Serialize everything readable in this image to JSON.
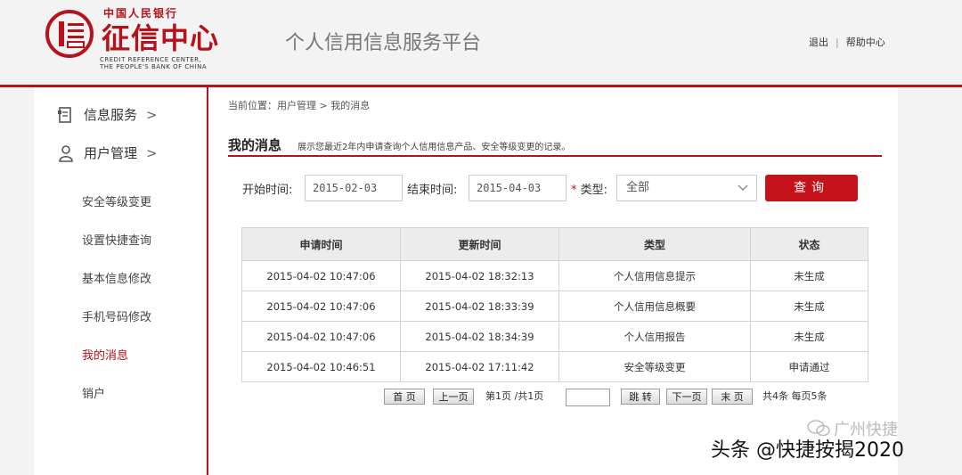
{
  "header": {
    "logo_small": "中国人民银行",
    "logo_big": "征信中心",
    "logo_en_line1": "CREDIT REFERENCE CENTER,",
    "logo_en_line2": "THE PEOPLE'S BANK OF CHINA",
    "platform_title": "个人信用信息服务平台",
    "logout": "退出",
    "separator": "|",
    "help": "帮助中心"
  },
  "sidebar": {
    "info_service": "信息服务",
    "user_mgmt": "用户管理",
    "arrow": ">",
    "items": [
      {
        "label": "安全等级变更"
      },
      {
        "label": "设置快捷查询"
      },
      {
        "label": "基本信息修改"
      },
      {
        "label": "手机号码修改"
      },
      {
        "label": "我的消息"
      },
      {
        "label": "销户"
      }
    ]
  },
  "breadcrumb": "当前位置：用户管理 > 我的消息",
  "page": {
    "title": "我的消息",
    "desc": "展示您最近2年内申请查询个人信用信息产品、安全等级变更的记录。"
  },
  "filters": {
    "start_label": "开始时间:",
    "start_value": "2015-02-03",
    "end_label": "结束时间:",
    "end_value": "2015-04-03",
    "type_star": "*",
    "type_label": "类型:",
    "type_value": "全部",
    "query_button": "查询"
  },
  "table": {
    "headers": [
      "申请时间",
      "更新时间",
      "类型",
      "状态"
    ],
    "rows": [
      [
        "2015-04-02 10:47:06",
        "2015-04-02 18:32:13",
        "个人信用信息提示",
        "未生成"
      ],
      [
        "2015-04-02 10:47:06",
        "2015-04-02 18:33:39",
        "个人信用信息概要",
        "未生成"
      ],
      [
        "2015-04-02 10:47:06",
        "2015-04-02 18:34:39",
        "个人信用报告",
        "未生成"
      ],
      [
        "2015-04-02 10:46:51",
        "2015-04-02 17:11:42",
        "安全等级变更",
        "申请通过"
      ]
    ]
  },
  "pager": {
    "first": "首 页",
    "prev": "上一页",
    "page_info": "第1页 /共1页",
    "jump": "跳 转",
    "next": "下一页",
    "last": "末 页",
    "summary": "共4条 每页5条"
  },
  "watermark": {
    "account": "广州快捷",
    "caption": "头条 @快捷按揭2020"
  },
  "colors": {
    "brand_red": "#b5121b"
  }
}
